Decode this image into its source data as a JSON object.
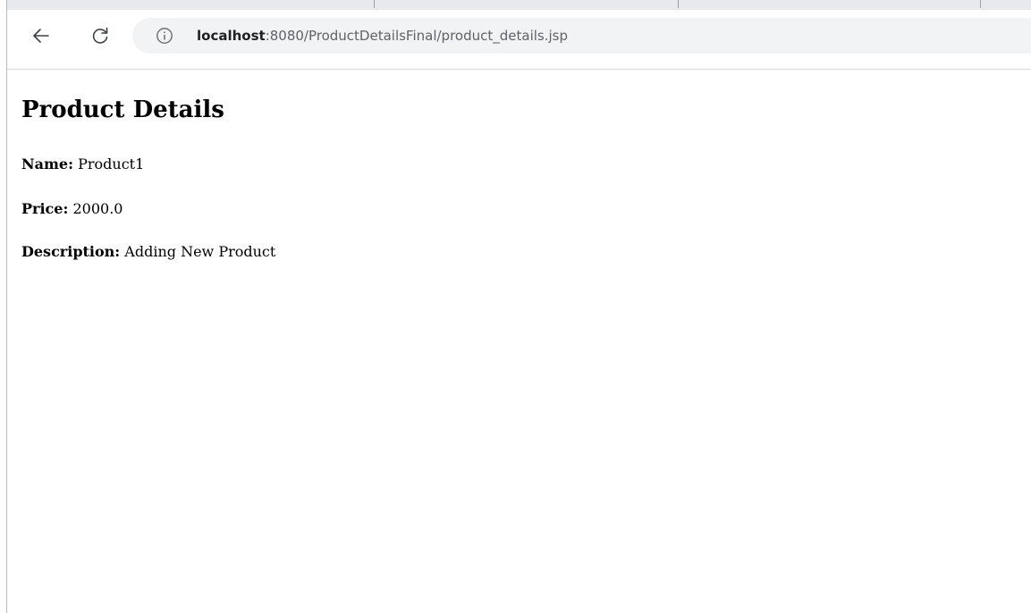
{
  "browser": {
    "url_host": "localhost",
    "url_path": ":8080/ProductDetailsFinal/product_details.jsp",
    "icons": {
      "back": "arrow-left-icon",
      "reload": "reload-icon",
      "site_info": "info-circle-icon"
    }
  },
  "page": {
    "title": "Product Details",
    "fields": [
      {
        "label": "Name:",
        "value": "Product1"
      },
      {
        "label": "Price:",
        "value": "2000.0"
      },
      {
        "label": "Description:",
        "value": "Adding New Product"
      }
    ]
  }
}
